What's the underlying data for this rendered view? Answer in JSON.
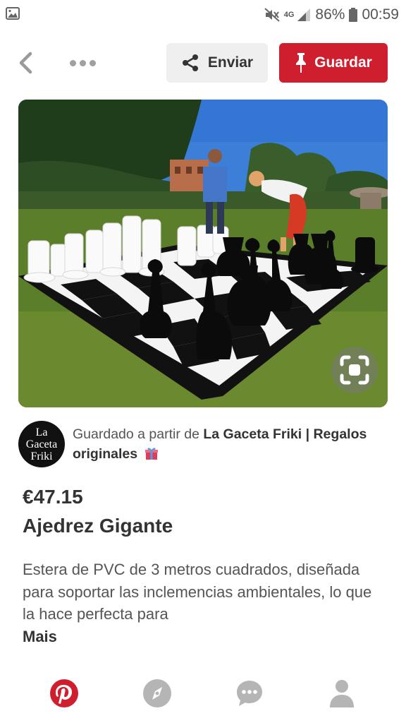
{
  "status_bar": {
    "network": "4G",
    "battery": "86%",
    "time": "00:59",
    "icons": [
      "image-notification-icon",
      "mute-icon",
      "signal-icon",
      "battery-icon"
    ]
  },
  "toolbar": {
    "send_label": "Enviar",
    "save_label": "Guardar",
    "save_color": "#cf1f2f"
  },
  "source": {
    "logo_lines": [
      "La",
      "Gaceta",
      "Friki"
    ],
    "prefix": "Guardado a partir de ",
    "name": "La Gaceta Friki | Regalos originales"
  },
  "pin": {
    "price": "€47.15",
    "title": "Ajedrez Gigante",
    "description": "Estera de PVC de 3 metros cuadrados, diseñada para soportar las inclemencias ambientales, lo que la hace perfecta para",
    "more_label": "Mais"
  },
  "nav": {
    "items": [
      "home-pinterest-icon",
      "explore-icon",
      "messages-icon",
      "profile-icon"
    ],
    "active_color": "#cf1f2f",
    "inactive_color": "#b5b5b5"
  }
}
